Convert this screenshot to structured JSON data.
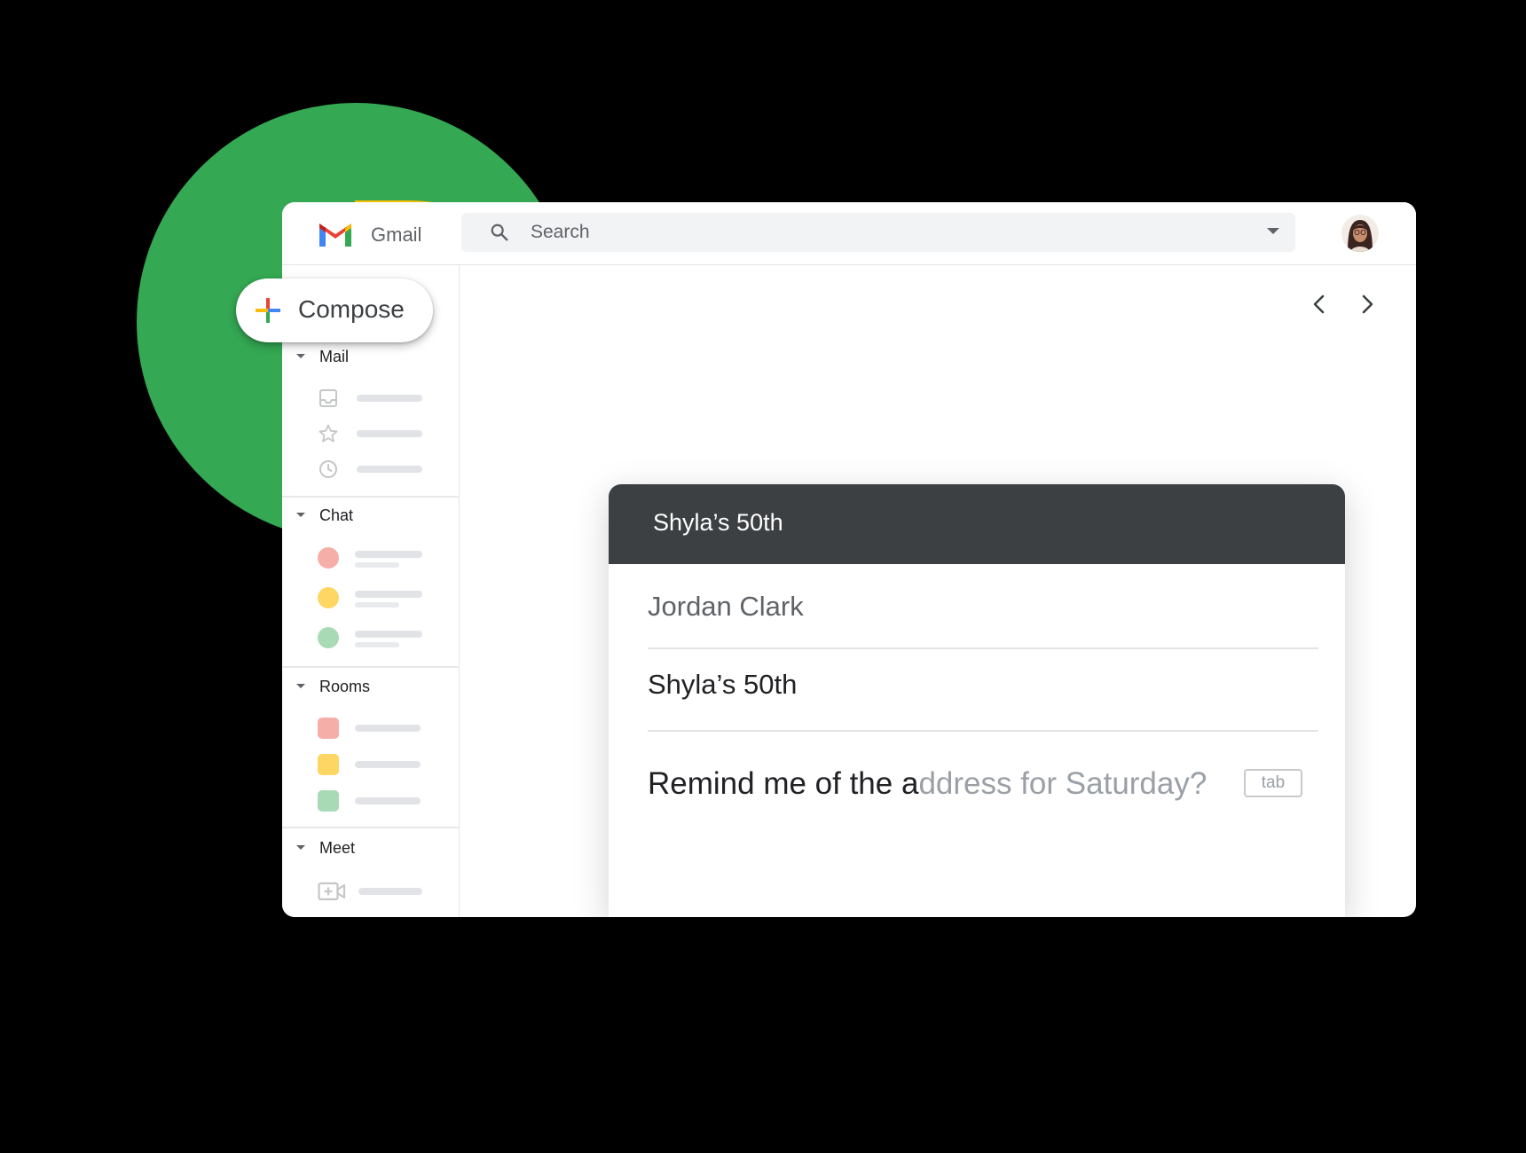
{
  "header": {
    "app_title": "Gmail",
    "search_placeholder": "Search",
    "logo_icon": "gmail-m-icon",
    "avatar_icon": "user-avatar"
  },
  "compose": {
    "label": "Compose",
    "icon": "colored-plus-icon"
  },
  "sidebar": {
    "sections": [
      {
        "label": "Mail",
        "items": [
          {
            "icon": "inbox-icon"
          },
          {
            "icon": "star-icon"
          },
          {
            "icon": "clock-icon"
          }
        ]
      },
      {
        "label": "Chat",
        "items": [
          {
            "color": "#F6AEA9"
          },
          {
            "color": "#FDD663"
          },
          {
            "color": "#A8DAB5"
          }
        ]
      },
      {
        "label": "Rooms",
        "items": [
          {
            "color": "#F6AEA9"
          },
          {
            "color": "#FDD663"
          },
          {
            "color": "#A8DAB5"
          }
        ]
      },
      {
        "label": "Meet",
        "items": [
          {
            "icon": "video-add-icon"
          }
        ]
      }
    ]
  },
  "navigation": {
    "prev_icon": "chevron-left-icon",
    "next_icon": "chevron-right-icon"
  },
  "compose_window": {
    "title": "Shyla’s 50th",
    "to": "Jordan Clark",
    "subject": "Shyla’s 50th",
    "body_typed": "Remind me of the a",
    "body_suggestion": "ddress for Saturday?",
    "accept_hint": "tab"
  },
  "colors": {
    "background": "#000000",
    "green": "#34A853",
    "yellow": "#FBBC04",
    "card_header": "#3C4043"
  }
}
